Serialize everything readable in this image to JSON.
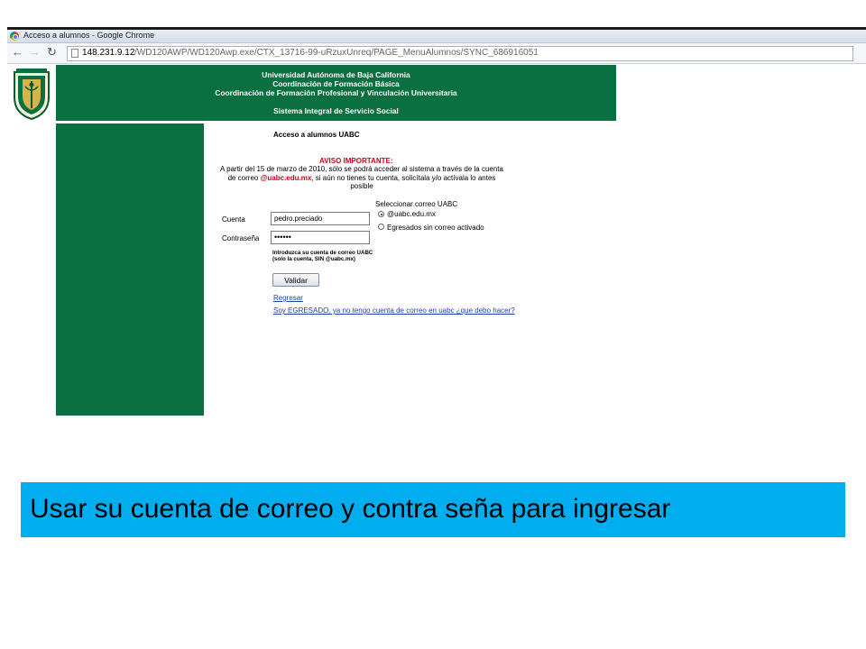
{
  "browser": {
    "window_title": "Acceso a alumnos - Google Chrome",
    "url_host": "148.231.9.12",
    "url_path": "/WD120AWP/WD120Awp.exe/CTX_13716-99-uRzuxUnreq/PAGE_MenuAlumnos/SYNC_686916051",
    "icons": [
      "chrome-logo-icon",
      "back-arrow-icon",
      "forward-arrow-icon",
      "reload-icon",
      "page-icon"
    ]
  },
  "header": {
    "line1": "Universidad Autónoma de Baja California",
    "line2": "Coordinación de Formación Básica",
    "line3": "Coordinación de Formación Profesional y Vinculación Universitaria",
    "line4": "Sistema Integral de Servicio Social",
    "banner_color": "#0b7041"
  },
  "login": {
    "title": "Acceso a alumnos UABC",
    "notice_title": "AVISO IMPORTANTE:",
    "notice_part1": "A partir del 15 de marzo de 2010, sólo se podrá acceder al sistema a través de la cuenta de correo ",
    "notice_email": "@uabc.edu.mx",
    "notice_part2": ", si aún no tienes tu cuenta, solicítala y/o actívala lo antes posible",
    "account_label": "Cuenta",
    "account_value": "pedro.preciado",
    "password_label": "Contraseña",
    "password_value": "••••••",
    "hint_line1": "Introduzca su cuenta de correo UABC",
    "hint_line2": "(solo la cuenta, SIN @uabc.mx)",
    "email_select_label": "Seleccionar correo UABC",
    "radio_options": [
      {
        "label": "@uabc.edu.mx",
        "selected": true
      },
      {
        "label": "Egresados sin correo activado",
        "selected": false
      }
    ],
    "submit_label": "Validar",
    "back_link": "Regresar",
    "graduate_link": "Soy EGRESADO, ya no tengo cuenta de correo en uabc ¿que debo hacer?"
  },
  "caption": {
    "text": "Usar su cuenta de correo y contra seña para ingresar",
    "background": "#00aeef"
  }
}
